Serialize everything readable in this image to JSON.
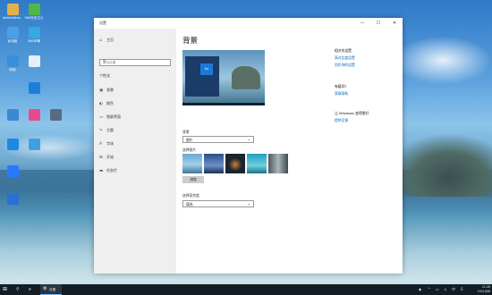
{
  "desktop": {
    "icons": [
      {
        "label": "Administra...",
        "icon": "user-folder-icon",
        "color": "#e2b24a"
      },
      {
        "label": "360安全卫士",
        "icon": "360-security-icon",
        "color": "#4cb848"
      },
      {
        "label": "此电脑",
        "icon": "computer-icon",
        "color": "#4aa0e6"
      },
      {
        "label": "360杀毒",
        "icon": "360-antivirus-icon",
        "color": "#37a9e0"
      },
      {
        "label": "网络",
        "icon": "network-icon",
        "color": "#3a8fd8"
      },
      {
        "label": "",
        "icon": "document-icon",
        "color": "#e8eef7"
      },
      {
        "label": "",
        "icon": "shield-app-icon",
        "color": "#1e7fd8"
      },
      {
        "label": "",
        "icon": "display-icon",
        "color": "#3b8ad0"
      },
      {
        "label": "",
        "icon": "photo-app-icon",
        "color": "#e64a8a"
      },
      {
        "label": "",
        "icon": "pc-icon",
        "color": "#5a6b80"
      },
      {
        "label": "",
        "icon": "edge-icon",
        "color": "#1e88e5"
      },
      {
        "label": "",
        "icon": "ie-icon",
        "color": "#3fa0e0"
      },
      {
        "label": "",
        "icon": "sogou-icon",
        "color": "#2979ff"
      },
      {
        "label": "",
        "icon": "wps-icon",
        "color": "#2b6fd6"
      }
    ]
  },
  "window": {
    "title": "设置",
    "buttons": {
      "minimize": "—",
      "maximize": "☐",
      "close": "✕"
    }
  },
  "sidebar": {
    "home": "主页",
    "search_placeholder": "查找设置",
    "section": "个性化",
    "items": [
      {
        "label": "背景",
        "icon": "image-icon"
      },
      {
        "label": "颜色",
        "icon": "palette-icon"
      },
      {
        "label": "锁屏界面",
        "icon": "lock-screen-icon"
      },
      {
        "label": "主题",
        "icon": "brush-icon"
      },
      {
        "label": "字体",
        "icon": "font-icon"
      },
      {
        "label": "开始",
        "icon": "start-icon"
      },
      {
        "label": "任务栏",
        "icon": "taskbar-icon"
      }
    ]
  },
  "main": {
    "title": "背景",
    "background_label": "背景",
    "background_value": "图片",
    "choose_picture_label": "选择图片",
    "browse_button": "浏览",
    "fit_label": "选择契合度",
    "fit_value": "填充",
    "preview_tile": "Aa"
  },
  "related": {
    "title": "相关的设置",
    "links": [
      "高对比度设置",
      "同步你的设置"
    ],
    "help_title": "有疑问?",
    "help_link": "获取帮助",
    "improve_title": "让 Windows 变得更好",
    "improve_link": "提供反馈"
  },
  "taskbar": {
    "active_app": "设置",
    "time": "11:26",
    "date": "2021/6/8"
  }
}
